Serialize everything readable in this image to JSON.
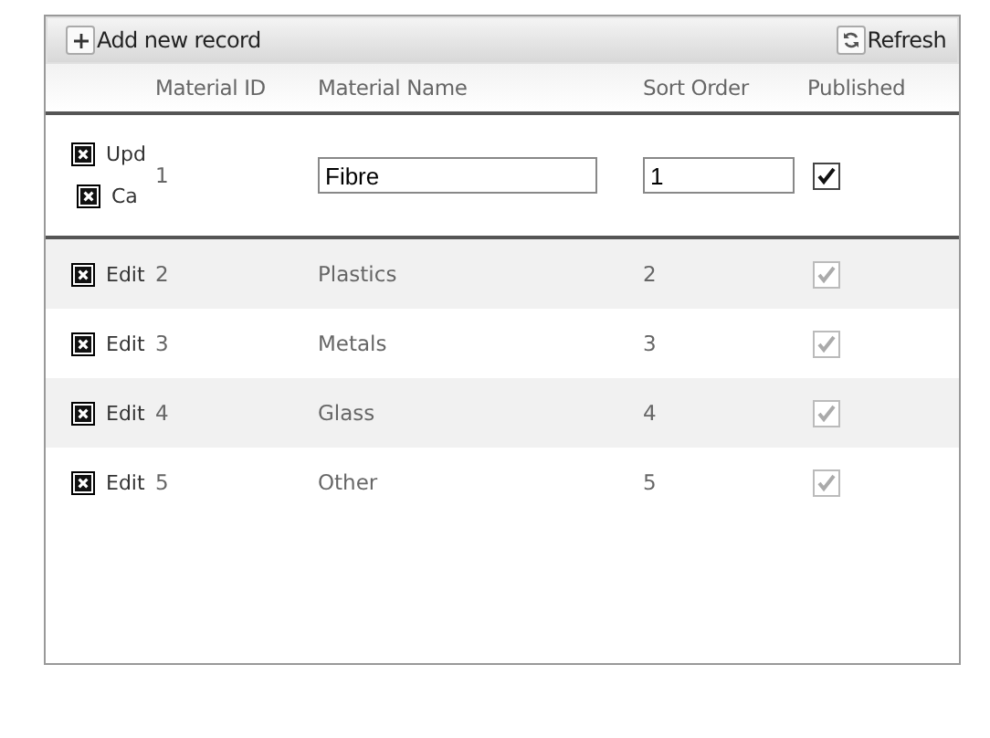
{
  "toolbar": {
    "add_label": "Add new record",
    "refresh_label": "Refresh"
  },
  "columns": [
    "Material ID",
    "Material Name",
    "Sort Order",
    "Published"
  ],
  "edit_row": {
    "update_label": "Upd",
    "cancel_label": "Ca",
    "id": "1",
    "name": "Fibre",
    "sort_order": "1",
    "published": true
  },
  "rows": [
    {
      "edit_label": "Edit",
      "id": "2",
      "name": "Plastics",
      "sort_order": "2",
      "published": true
    },
    {
      "edit_label": "Edit",
      "id": "3",
      "name": "Metals",
      "sort_order": "3",
      "published": true
    },
    {
      "edit_label": "Edit",
      "id": "4",
      "name": "Glass",
      "sort_order": "4",
      "published": true
    },
    {
      "edit_label": "Edit",
      "id": "5",
      "name": "Other",
      "sort_order": "5",
      "published": true
    }
  ]
}
